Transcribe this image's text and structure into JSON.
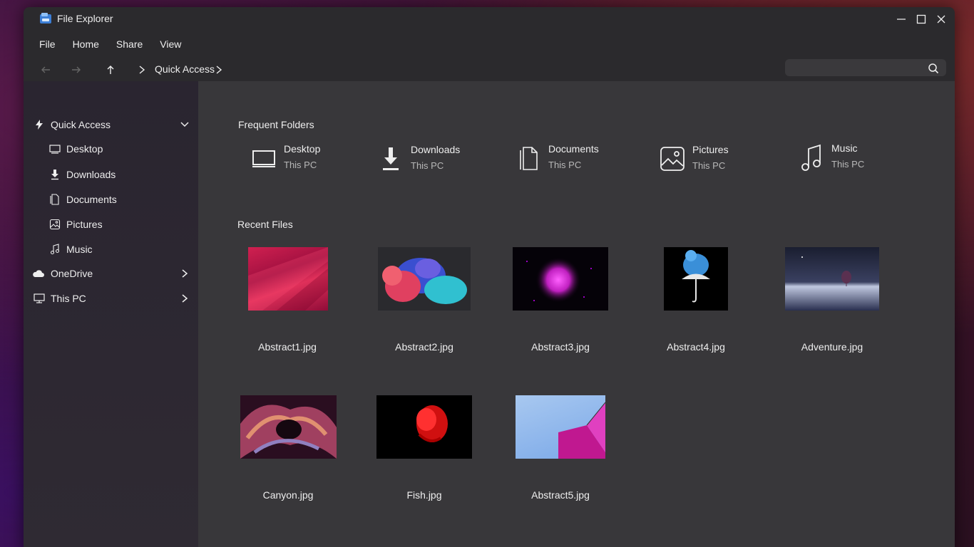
{
  "window": {
    "title": "File Explorer"
  },
  "menu": [
    "File",
    "Home",
    "Share",
    "View"
  ],
  "breadcrumb": {
    "location": "Quick Access"
  },
  "search": {
    "placeholder": "",
    "value": ""
  },
  "sidebar": {
    "quick_access": "Quick Access",
    "items": [
      "Desktop",
      "Downloads",
      "Documents",
      "Pictures",
      "Music"
    ],
    "onedrive": "OneDrive",
    "thispc": "This PC"
  },
  "frequent": {
    "title": "Frequent Folders",
    "folders": [
      {
        "name": "Desktop",
        "location": "This PC",
        "icon": "monitor-icon"
      },
      {
        "name": "Downloads",
        "location": "This PC",
        "icon": "download-icon"
      },
      {
        "name": "Documents",
        "location": "This PC",
        "icon": "document-icon"
      },
      {
        "name": "Pictures",
        "location": "This PC",
        "icon": "picture-icon"
      },
      {
        "name": "Music",
        "location": "This PC",
        "icon": "music-icon"
      }
    ]
  },
  "recent": {
    "title": "Recent Files",
    "files": [
      "Abstract1.jpg",
      "Abstract2.jpg",
      "Abstract3.jpg",
      "Abstract4.jpg",
      "Adventure.jpg",
      "Canyon.jpg",
      "Fish.jpg",
      "Abstract5.jpg"
    ]
  },
  "colors": {
    "window_bg": "#2b2a2d",
    "content_bg": "#38373a",
    "accent": "#4a90e2"
  }
}
